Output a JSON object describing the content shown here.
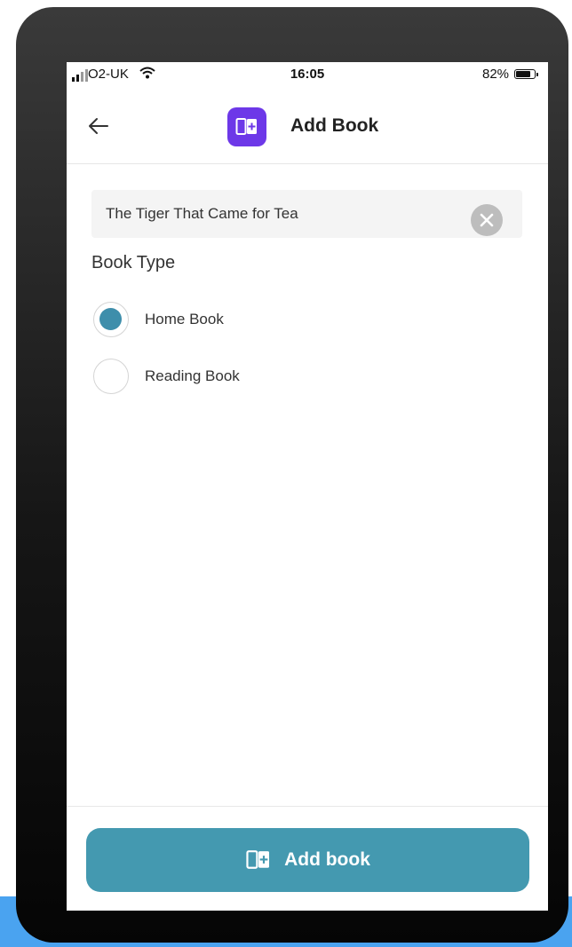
{
  "status_bar": {
    "carrier": "O2-UK",
    "time": "16:05",
    "battery_percent": "82%",
    "battery_level": 0.82
  },
  "header": {
    "title": "Add Book",
    "back_icon": "arrow-left-icon",
    "logo_icon": "book-plus-icon",
    "logo_color": "#6d38e8"
  },
  "form": {
    "title_value": "The Tiger That Came for Tea",
    "clear_icon": "close-circle-icon",
    "book_type_label": "Book Type",
    "options": [
      {
        "label": "Home Book",
        "selected": true
      },
      {
        "label": "Reading Book",
        "selected": false
      }
    ]
  },
  "footer": {
    "button_label": "Add book",
    "button_icon": "book-plus-icon",
    "button_color": "#4499b0"
  },
  "colors": {
    "radio_selected": "#3e8eab",
    "page_accent": "#4aa3f0"
  }
}
